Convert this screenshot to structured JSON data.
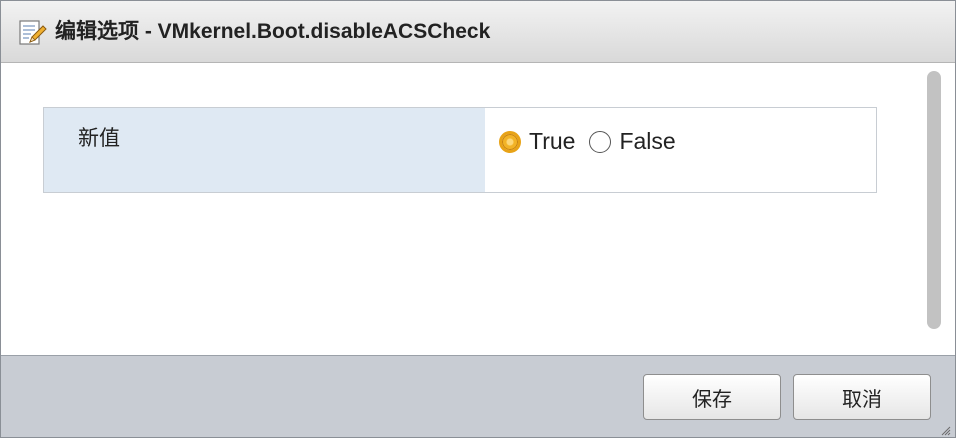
{
  "dialog": {
    "title": "编辑选项 - VMkernel.Boot.disableACSCheck"
  },
  "form": {
    "label": "新值",
    "options": [
      {
        "label": "True",
        "checked": true
      },
      {
        "label": "False",
        "checked": false
      }
    ]
  },
  "footer": {
    "save_label": "保存",
    "cancel_label": "取消"
  },
  "icons": {
    "title": "edit-document-icon",
    "grip": "resize-grip-icon"
  },
  "colors": {
    "label_cell_bg": "#dfe9f3",
    "footer_bg": "#c8ccd3",
    "radio_accent": "#e8a317"
  }
}
